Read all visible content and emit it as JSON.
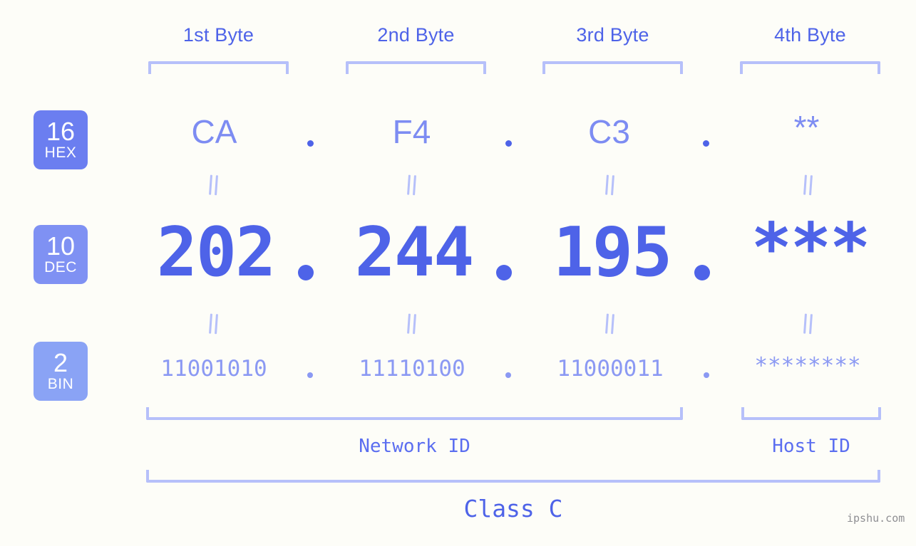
{
  "background_color": "#fdfdf8",
  "accent_color": "#4e63e8",
  "bracket_color": "#b6c0fa",
  "byte_headers": [
    {
      "label": "1st Byte"
    },
    {
      "label": "2nd Byte"
    },
    {
      "label": "3rd Byte"
    },
    {
      "label": "4th Byte"
    }
  ],
  "rows": [
    {
      "badge_number": "16",
      "badge_name": "HEX",
      "badge_color": "#6b7ef0",
      "values": [
        "CA",
        "F4",
        "C3",
        "**"
      ],
      "separator": "."
    },
    {
      "badge_number": "10",
      "badge_name": "DEC",
      "badge_color": "#7f91f3",
      "values": [
        "202",
        "244",
        "195",
        "***"
      ],
      "separator": "."
    },
    {
      "badge_number": "2",
      "badge_name": "BIN",
      "badge_color": "#8aa3f5",
      "values": [
        "11001010",
        "11110100",
        "11000011",
        "********"
      ],
      "separator": "."
    }
  ],
  "equals_marker": "=",
  "id_sections": [
    {
      "label": "Network ID"
    },
    {
      "label": "Host ID"
    }
  ],
  "class_label": "Class C",
  "watermark": "ipshu.com"
}
